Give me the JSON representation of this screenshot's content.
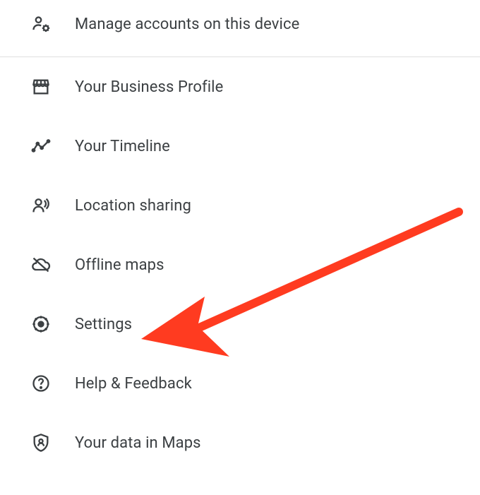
{
  "menu": {
    "manageAccounts": {
      "label": "Manage accounts on this device"
    },
    "businessProfile": {
      "label": "Your Business Profile"
    },
    "timeline": {
      "label": "Your Timeline"
    },
    "locationSharing": {
      "label": "Location sharing"
    },
    "offlineMaps": {
      "label": "Offline maps"
    },
    "settings": {
      "label": "Settings"
    },
    "helpFeedback": {
      "label": "Help & Feedback"
    },
    "dataInMaps": {
      "label": "Your data in Maps"
    }
  },
  "annotation": {
    "arrowColor": "#ff3b20"
  }
}
